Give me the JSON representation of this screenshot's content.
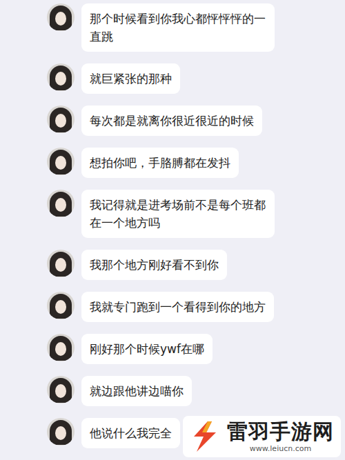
{
  "messages": [
    {
      "text": "那个时候看到你我心都怦怦怦的一直跳"
    },
    {
      "text": "就巨紧张的那种"
    },
    {
      "text": "每次都是就离你很近很近的时候"
    },
    {
      "text": "想拍你吧，手胳膊都在发抖"
    },
    {
      "text": "我记得就是进考场前不是每个班都在一个地方吗"
    },
    {
      "text": "我那个地方刚好看不到你"
    },
    {
      "text": "我就专门跑到一个看得到你的地方"
    },
    {
      "text": "刚好那个时候ywf在哪"
    },
    {
      "text": "就边跟他讲边喵你"
    },
    {
      "text": "他说什么我完全"
    }
  ],
  "watermark": {
    "name": "雷羽手游网",
    "url": "www.leiucn.com"
  }
}
